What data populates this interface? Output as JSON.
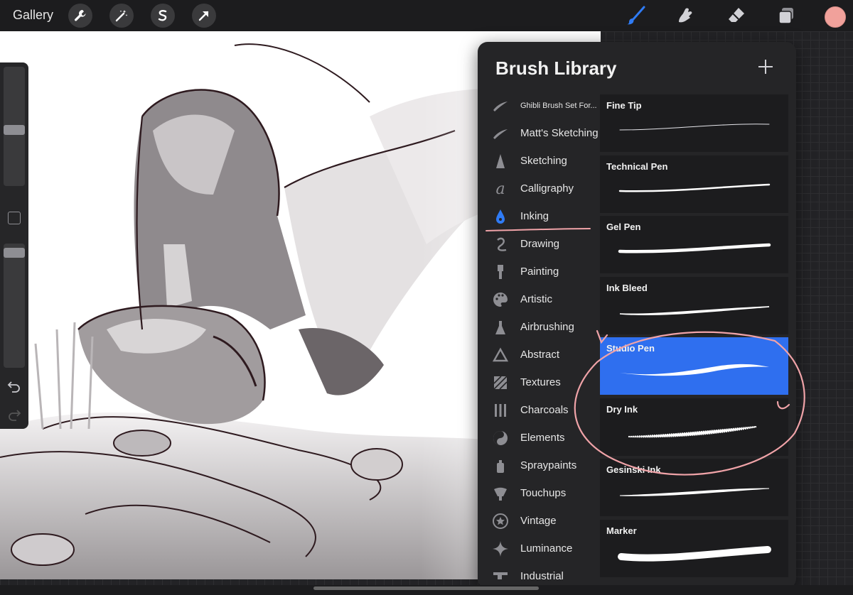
{
  "toolbar": {
    "gallery_label": "Gallery",
    "left_tools": [
      "wrench-icon",
      "magic-wand-icon",
      "selection-icon",
      "transform-arrow-icon"
    ],
    "right_tools": [
      "brush-icon",
      "smudge-icon",
      "eraser-icon",
      "layers-icon"
    ],
    "active_tool": "brush-icon",
    "current_color": "#f1a19b"
  },
  "sidebar": {
    "brush_size_level": 0.35,
    "opacity_level": 0.05,
    "icons": [
      "modify-square-icon",
      "undo-icon",
      "redo-icon"
    ]
  },
  "brush_library": {
    "title": "Brush Library",
    "add_icon": "plus-icon",
    "categories": [
      {
        "label": "Ghibli Brush Set For...",
        "icon": "stroke-thumbnail-icon"
      },
      {
        "label": "Matt's Sketching",
        "icon": "stroke-thumbnail-icon"
      },
      {
        "label": "Sketching",
        "icon": "pencil-tip-icon"
      },
      {
        "label": "Calligraphy",
        "icon": "calligraphy-a-icon"
      },
      {
        "label": "Inking",
        "icon": "pen-nib-icon"
      },
      {
        "label": "Drawing",
        "icon": "squiggle-icon"
      },
      {
        "label": "Painting",
        "icon": "paintbrush-icon"
      },
      {
        "label": "Artistic",
        "icon": "palette-icon"
      },
      {
        "label": "Airbrushing",
        "icon": "airbrush-icon"
      },
      {
        "label": "Abstract",
        "icon": "triangle-icon"
      },
      {
        "label": "Textures",
        "icon": "hatched-square-icon"
      },
      {
        "label": "Charcoals",
        "icon": "charcoal-sticks-icon"
      },
      {
        "label": "Elements",
        "icon": "yin-yang-icon"
      },
      {
        "label": "Spraypaints",
        "icon": "spray-can-icon"
      },
      {
        "label": "Touchups",
        "icon": "touchup-icon"
      },
      {
        "label": "Vintage",
        "icon": "star-badge-icon"
      },
      {
        "label": "Luminance",
        "icon": "sparkle-icon"
      },
      {
        "label": "Industrial",
        "icon": "anvil-icon"
      }
    ],
    "selected_category": "Inking",
    "brushes": [
      {
        "name": "Fine Tip"
      },
      {
        "name": "Technical Pen"
      },
      {
        "name": "Gel Pen"
      },
      {
        "name": "Ink Bleed"
      },
      {
        "name": "Studio Pen"
      },
      {
        "name": "Dry Ink"
      },
      {
        "name": "Gesinski Ink"
      },
      {
        "name": "Marker"
      }
    ],
    "selected_brush": "Studio Pen",
    "accent_color": "#2f6fef",
    "annotation_color": "#f0a3a8"
  }
}
